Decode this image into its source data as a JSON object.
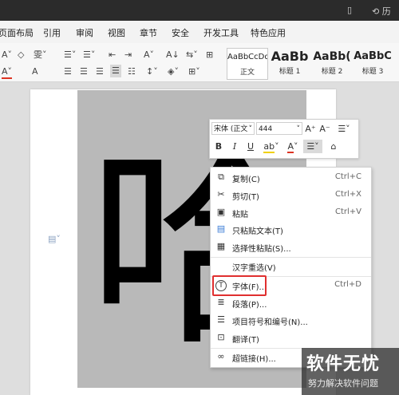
{
  "menubar": {
    "tabs": [
      "页面布局",
      "引用",
      "审阅",
      "视图",
      "章节",
      "安全",
      "开发工具",
      "特色应用"
    ]
  },
  "ribbon": {
    "styles": [
      {
        "sample": "AaBbCcDd",
        "label": "正文"
      },
      {
        "sample": "AaBb",
        "label": "标题 1"
      },
      {
        "sample": "AaBb(",
        "label": "标题 2"
      },
      {
        "sample": "AaBbC",
        "label": "标题 3"
      }
    ]
  },
  "document": {
    "big_char": "哈"
  },
  "mini_toolbar": {
    "font_name": "宋体 (正文",
    "font_size": "444",
    "bold": "B",
    "italic": "I",
    "underline": "U",
    "grow_font": "A⁺",
    "shrink_font": "A⁻"
  },
  "context_menu": {
    "items": [
      {
        "label": "复制(C)",
        "shortcut": "Ctrl+C",
        "icon": "copy-icon"
      },
      {
        "label": "剪切(T)",
        "shortcut": "Ctrl+X",
        "icon": "scissors-icon"
      },
      {
        "label": "粘贴",
        "shortcut": "Ctrl+V",
        "icon": "paste-icon"
      },
      {
        "label": "只粘贴文本(T)",
        "shortcut": "",
        "icon": "paste-text-icon"
      },
      {
        "label": "选择性粘贴(S)...",
        "shortcut": "",
        "icon": "paste-special-icon"
      },
      {
        "label": "汉字重选(V)",
        "shortcut": "",
        "icon": ""
      },
      {
        "label": "字体(F)...",
        "shortcut": "Ctrl+D",
        "icon": "font-icon"
      },
      {
        "label": "段落(P)...",
        "shortcut": "",
        "icon": "paragraph-icon"
      },
      {
        "label": "项目符号和编号(N)...",
        "shortcut": "",
        "icon": "bullets-icon"
      },
      {
        "label": "翻译(T)",
        "shortcut": "",
        "icon": "translate-icon"
      },
      {
        "label": "超链接(H)...",
        "shortcut": "",
        "icon": "link-icon"
      }
    ]
  },
  "watermark": {
    "title": "软件无忧",
    "subtitle": "努力解决软件问题"
  }
}
